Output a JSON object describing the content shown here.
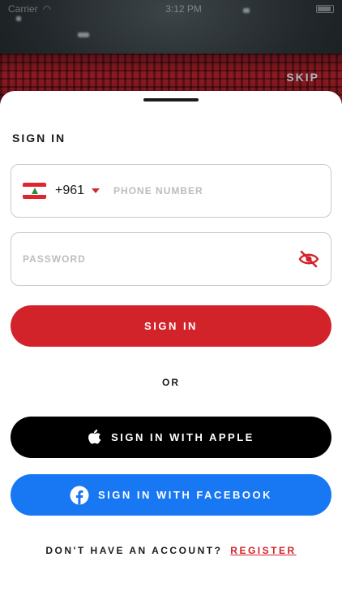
{
  "status_bar": {
    "carrier": "Carrier",
    "time": "3:12 PM"
  },
  "header": {
    "skip_label": "SKIP"
  },
  "form": {
    "title": "SIGN IN",
    "phone": {
      "country_code": "+961",
      "country_flag": "lebanon-flag",
      "placeholder": "PHONE NUMBER",
      "value": ""
    },
    "password": {
      "placeholder": "PASSWORD",
      "value": ""
    }
  },
  "buttons": {
    "sign_in": "SIGN IN",
    "or_label": "OR",
    "apple": "SIGN IN WITH APPLE",
    "facebook": "SIGN IN WITH FACEBOOK"
  },
  "footer": {
    "prompt": "DON'T HAVE AN ACCOUNT?",
    "register": "REGISTER"
  },
  "colors": {
    "accent": "#d2232a",
    "apple": "#000000",
    "facebook": "#1877f2",
    "border": "#c9c9c9"
  }
}
